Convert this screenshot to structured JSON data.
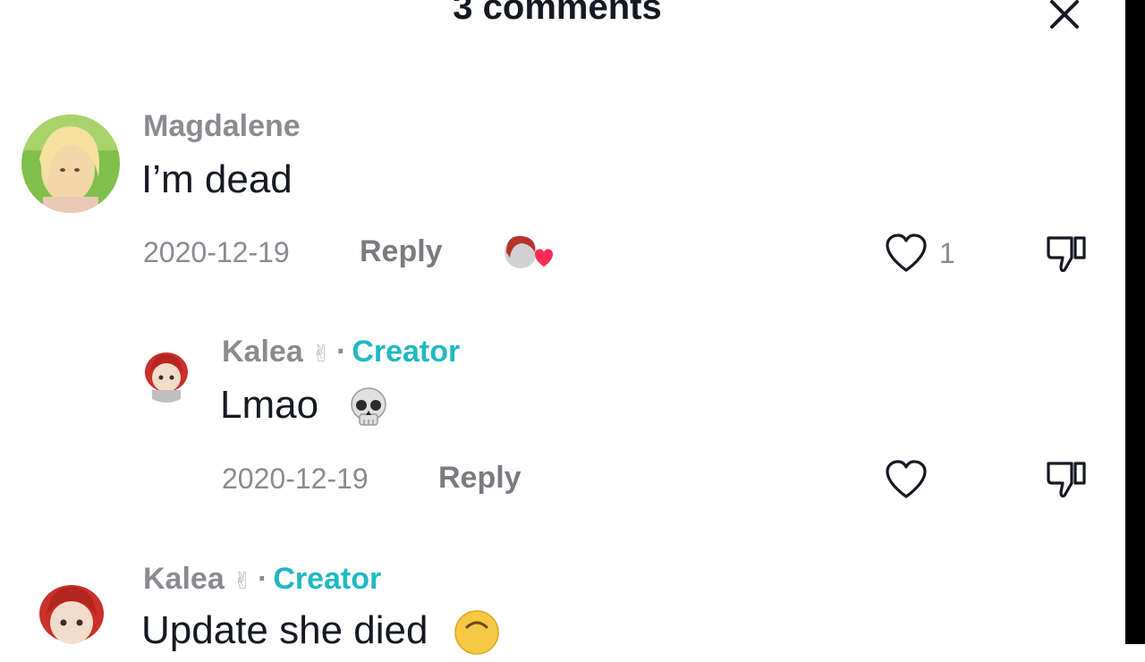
{
  "header": {
    "title": "3 comments"
  },
  "comments": [
    {
      "username": "Magdalene",
      "text": "I’m dead",
      "date": "2020-12-19",
      "reply_label": "Reply",
      "like_count": "1"
    },
    {
      "username": "Kalea",
      "username_emoji": "✌",
      "separator": "·",
      "badge": "Creator",
      "text": "Lmao",
      "date": "2020-12-19",
      "reply_label": "Reply"
    },
    {
      "username": "Kalea",
      "username_emoji": "✌",
      "separator": "·",
      "badge": "Creator",
      "text": "Update she died"
    }
  ],
  "colors": {
    "creator_badge": "#20b8c4",
    "muted_text": "#8a8b91",
    "heart_red": "#fe2c55"
  }
}
